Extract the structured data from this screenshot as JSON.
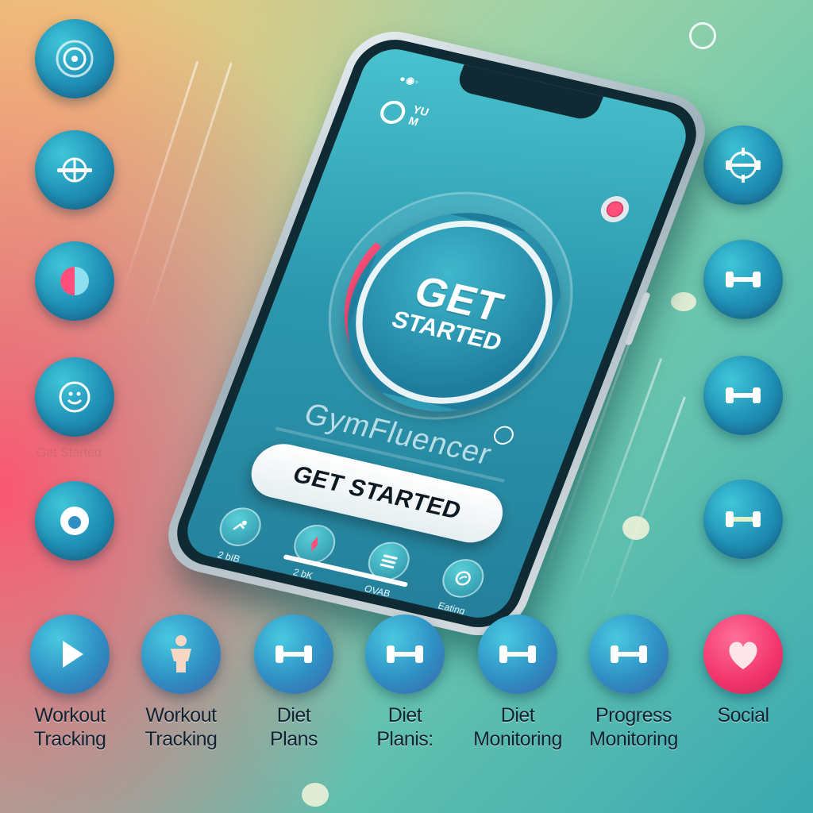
{
  "phone": {
    "status": "●◉◦",
    "app_logo_text": "YU M",
    "big_button": {
      "line1": "GET",
      "line2": "STARTED"
    },
    "brand": "GymFluencer",
    "cta_label": "GET STARTED",
    "nav": [
      {
        "label": "2 bIB",
        "icon": "runner-icon"
      },
      {
        "label": "2 bK",
        "icon": "compass-icon"
      },
      {
        "label": "OVAB",
        "icon": "menu-icon"
      },
      {
        "label": "Eating",
        "icon": "leaf-icon"
      }
    ]
  },
  "ghost_text": "Get Started",
  "side_icons_left": [
    "target-icon",
    "globe-icon",
    "pie-icon",
    "smile-icon",
    "drop-icon"
  ],
  "side_icons_right": [
    "crosshair-dumbbell-icon",
    "dumbbell-icon",
    "dumbbell-icon",
    "dumbbell-icon"
  ],
  "features": [
    {
      "label": "Workout\nTracking",
      "icon": "play-icon"
    },
    {
      "label": "Workout\nTracking",
      "icon": "body-icon"
    },
    {
      "label": "Diet\nPlans",
      "icon": "dumbbell-icon"
    },
    {
      "label": "Diet\nPlanis:",
      "icon": "dumbbell-icon"
    },
    {
      "label": "Diet\nMonitoring",
      "icon": "dumbbell-icon"
    },
    {
      "label": "Progress\nMonitoring",
      "icon": "dumbbell-icon"
    },
    {
      "label": "Social",
      "icon": "heart-icon"
    }
  ],
  "colors": {
    "accent_pink": "#ff4f7a",
    "accent_cyan": "#3fd1ef",
    "icon_blue": "#2f8fc4"
  }
}
